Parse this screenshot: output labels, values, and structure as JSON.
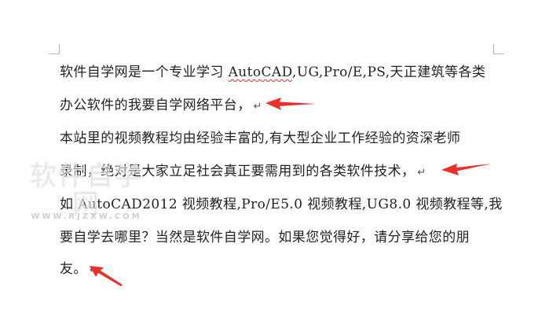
{
  "document": {
    "lines": [
      {
        "pre": "软件自学网是一个专业学习 ",
        "squiggle": "AutoCAD",
        "post": ",UG,Pro/E,PS,天正建筑等各类"
      },
      {
        "text": "办公软件的我要自学网络平台，",
        "mark": "↵"
      },
      {
        "text": "本站里的视频教程均由经验丰富的,有大型企业工作经验的资深老师"
      },
      {
        "text": "录制，绝对是大家立足社会真正要需用到的各类软件技术，",
        "mark": "↵"
      },
      {
        "text": "如 AutoCAD2012 视频教程,Pro/E5.0 视频教程,UG8.0 视频教程等,我"
      },
      {
        "text": "要自学去哪里？当然是软件自学网。如果您觉得好，请分享给您的朋"
      },
      {
        "text": "友。",
        "mark": "↵"
      }
    ]
  },
  "watermark": {
    "main": "软件自学网",
    "sub": "WWW.RJZXW.COM"
  },
  "colors": {
    "arrow": "#e8302c",
    "text": "#222222",
    "corner": "#b8b8b8",
    "squiggle": "#e03030"
  }
}
